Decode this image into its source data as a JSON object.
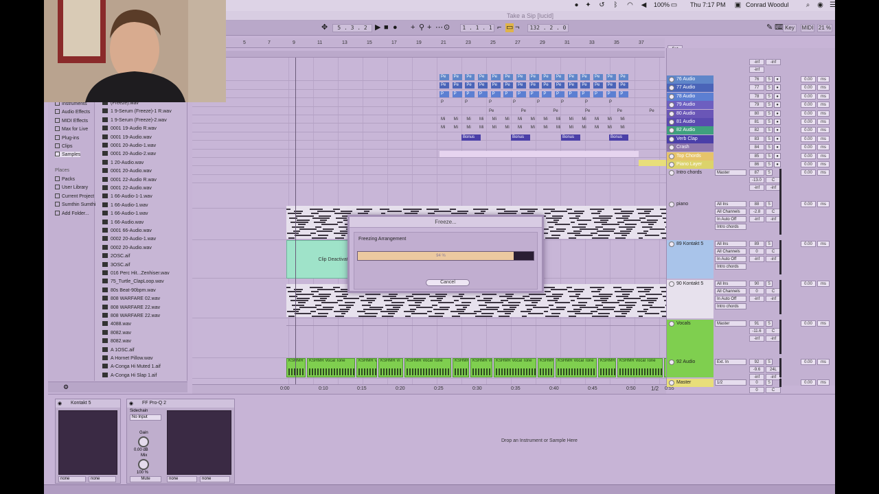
{
  "menubar": {
    "battery": "100%",
    "datetime": "Thu 7:17 PM",
    "user": "Conrad Woodul"
  },
  "window_title": "Take a Sip  [lucid]",
  "transport": {
    "arrangement_position": "5 . 3 . 2",
    "loop_start": "1 . 1 . 1",
    "loop_length": "132 . 2 . 0",
    "key_label": "Key",
    "midi_label": "MIDI",
    "cpu": "21 %"
  },
  "ruler": {
    "bars": [
      "5",
      "7",
      "9",
      "11",
      "13",
      "15",
      "17",
      "19",
      "21",
      "23",
      "25",
      "27",
      "29",
      "31",
      "33",
      "35",
      "37"
    ],
    "time": [
      "0:00",
      "0:10",
      "0:15",
      "0:20",
      "0:25",
      "0:30",
      "0:35",
      "0:40",
      "0:45",
      "0:50",
      "0:55"
    ],
    "set_label": "Set",
    "page": "1/2"
  },
  "browser": {
    "categories": [
      {
        "label": "Instruments"
      },
      {
        "label": "Audio Effects"
      },
      {
        "label": "MIDI Effects"
      },
      {
        "label": "Max for Live"
      },
      {
        "label": "Plug-ins"
      },
      {
        "label": "Clips"
      },
      {
        "label": "Samples"
      }
    ],
    "places_header": "Places",
    "places": [
      {
        "label": "Packs"
      },
      {
        "label": "User Library"
      },
      {
        "label": "Current Project"
      },
      {
        "label": "Sumthin Sumthin"
      },
      {
        "label": "Add Folder..."
      }
    ],
    "files": [
      "(Freeze).wav",
      "1 9-Serum (Freeze)-1 R.wav",
      "1 9-Serum (Freeze)-2.wav",
      "0001 19-Audio R.wav",
      "0001 19-Audio.wav",
      "0001 20-Audio-1.wav",
      "0001 20-Audio-2.wav",
      "1 20-Audio.wav",
      "0001 20-Audio.wav",
      "0001 22-Audio R.wav",
      "0001 22-Audio.wav",
      "1 66-Audio-1-1.wav",
      "1 66-Audio-1.wav",
      "1 66-Audio-1.wav",
      "1 66-Audio.wav",
      "0001 66-Audio.wav",
      "0002 20-Audio-1.wav",
      "0002 20-Audio.wav",
      "2OSC.aif",
      "3OSC.aif",
      "016 Perc Hit...Zenhiser.wav",
      "75_Turtle_ClapLoop.wav",
      "80s Beat-90bpm.wav",
      "808 WARFARE 02.wav",
      "808 WARFARE 22.wav",
      "808 WARFARE 22.wav",
      "4088.wav",
      "8082.wav",
      "8082.wav",
      "A 1OSC.aif",
      "A Hornet Pillow.wav",
      "A-Conga Hi Muted 1.aif",
      "A-Conga Hi Slap 1.aif"
    ]
  },
  "arrangement": {
    "clip_small_labels": {
      "pe": "Pe",
      "pi": "P",
      "mi": "Mi",
      "m": "M",
      "bonus": "Bonus"
    },
    "clip_deactivated": "Clip Deactivated",
    "vocal_clip": "KSHMR Vocal Tone",
    "vocal_clip_short": "KSHMR Vi",
    "vocal_clip_tiny": "KSHMR"
  },
  "tracks": [
    {
      "name": "76 Audio",
      "color": "#5f86c9",
      "num": "76"
    },
    {
      "name": "77 Audio",
      "color": "#4a64b8",
      "num": "77"
    },
    {
      "name": "78 Audio",
      "color": "#5c7fd2",
      "num": "78"
    },
    {
      "name": "79 Audio",
      "color": "#6d5fc0",
      "num": "79"
    },
    {
      "name": "80 Audio",
      "color": "#6a56b7",
      "num": "80"
    },
    {
      "name": "81 Audio",
      "color": "#5a4ab0",
      "num": "81"
    },
    {
      "name": "82 Audio",
      "color": "#3fa07e",
      "num": "82"
    },
    {
      "name": "Verb Clap",
      "color": "#4a3fa8",
      "num": "83"
    },
    {
      "name": "Crash",
      "color": "#8f78ae",
      "num": "84"
    },
    {
      "name": "Top Chords",
      "color": "#e6c36a",
      "num": "85"
    },
    {
      "name": "Piano Layer",
      "color": "#dcd36b",
      "num": "86"
    }
  ],
  "big_tracks": [
    {
      "name": "Intro chords",
      "io": "Master",
      "num": "87",
      "vol": "-13.0",
      "pan": "C",
      "send": "0.00"
    },
    {
      "name": "piano",
      "io": "All Ins",
      "num": "88",
      "vol": "-2.8",
      "pan": "C",
      "sub": "All Channels",
      "send": "0.00"
    },
    {
      "name": "89 Kontakt 5",
      "io": "All Ins",
      "num": "89",
      "vol": "0",
      "pan": "C",
      "sub": "All Channels",
      "send": "0.00"
    },
    {
      "name": "90 Kontakt 5",
      "io": "All Ins",
      "num": "90",
      "vol": "0",
      "pan": "C",
      "sub": "All Channels",
      "send": "0.00"
    },
    {
      "name": "Vocals",
      "io": "Master",
      "num": "91",
      "vol": "-11.6",
      "pan": "C",
      "send": "0.00"
    },
    {
      "name": "92 Audio",
      "io": "Ext. In",
      "num": "92",
      "vol": "-9.6",
      "pan": "24L",
      "send": "0.00"
    },
    {
      "name": "Master",
      "io": "1/2",
      "num": "0",
      "vol": "0",
      "pan": "C",
      "send": "0.00"
    }
  ],
  "mixer_labels": {
    "inf": "-inf",
    "in": "In",
    "auto": "Auto",
    "off": "Off",
    "s": "S",
    "ms": "ms",
    "intro_route": "Intro chords",
    "zero": "0.00"
  },
  "devices": {
    "kontakt": {
      "title": "Kontakt 5",
      "none1": "none",
      "none2": "none"
    },
    "ffpro": {
      "title": "FF Pro-Q 2",
      "sidechain": "Sidechain",
      "no_input": "No Input",
      "gain_label": "Gain",
      "gain_value": "0.00 dB",
      "mix_label": "Mix",
      "mix_value": "100 %",
      "mute": "Mute",
      "none1": "none",
      "none2": "none"
    },
    "drop_hint": "Drop an Instrument or Sample Here"
  },
  "dialog": {
    "title": "Freeze...",
    "message": "Freezing Arrangement",
    "progress_percent": 94,
    "progress_text": "94 %",
    "cancel_label": "Cancel"
  }
}
